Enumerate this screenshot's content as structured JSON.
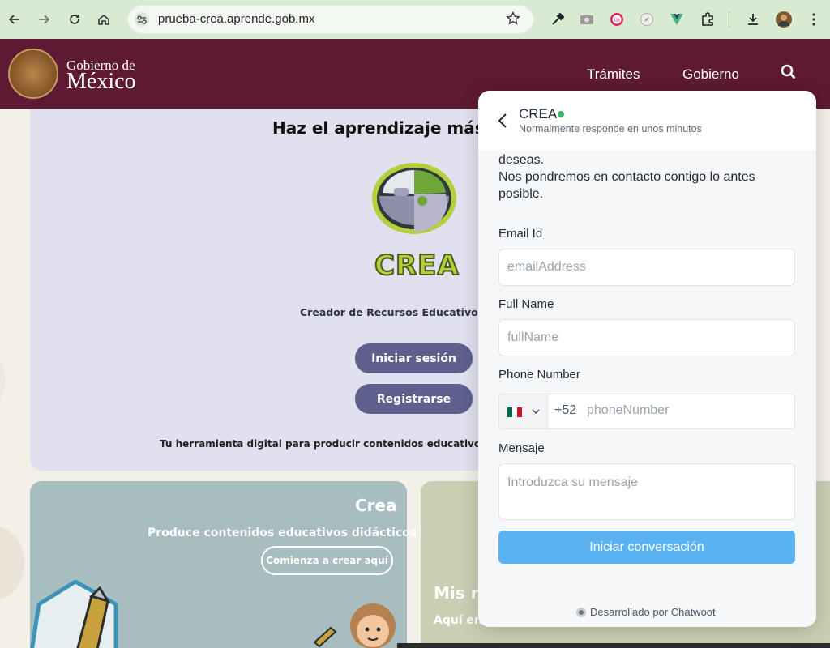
{
  "browser": {
    "url": "prueba-crea.aprende.gob.mx",
    "icons": [
      "back-icon",
      "forward-icon",
      "reload-icon",
      "home-icon",
      "site-settings-icon",
      "bookmark-star-icon",
      "eyedropper-icon",
      "camera-icon",
      "extension-m-icon",
      "compass-icon",
      "vue-icon",
      "puzzle-icon",
      "download-icon",
      "profile-avatar",
      "menu-kebab-icon"
    ]
  },
  "gov": {
    "brand_small": "Gobierno de",
    "brand_big": "México",
    "nav": [
      "Trámites",
      "Gobierno"
    ]
  },
  "hero": {
    "title": "Haz el aprendizaje más d",
    "logo_word": "CREA",
    "subtitle": "Creador de Recursos Educativos de",
    "login_label": "Iniciar sesión",
    "register_label": "Registrarse",
    "footer": "Tu herramienta digital para producir contenidos educativos dig"
  },
  "cards": {
    "crea_title": "Crea",
    "crea_sub": "Produce contenidos educativos didácticos",
    "crea_button": "Comienza a crear aquí",
    "mis_title": "Mis re",
    "mis_sub": "Aquí en"
  },
  "chat": {
    "name": "CREA",
    "status": "Normalmente responde en unos minutos",
    "intro_line1": "deseas.",
    "intro_line2": "Nos pondremos en contacto contigo lo antes posible.",
    "email_label": "Email Id",
    "email_placeholder": "emailAddress",
    "name_label": "Full Name",
    "name_placeholder": "fullName",
    "phone_label": "Phone Number",
    "dial_code": "+52",
    "phone_placeholder": "phoneNumber",
    "message_label": "Mensaje",
    "message_placeholder": "Introduzca su mensaje",
    "submit_label": "Iniciar conversación",
    "powered_by": "Desarrollado por Chatwoot"
  },
  "colors": {
    "gov_maroon": "#5e1a32",
    "chat_button": "#5ab2f2",
    "pill_button": "#5e5f8d",
    "browser_bar": "#d9ead3"
  }
}
